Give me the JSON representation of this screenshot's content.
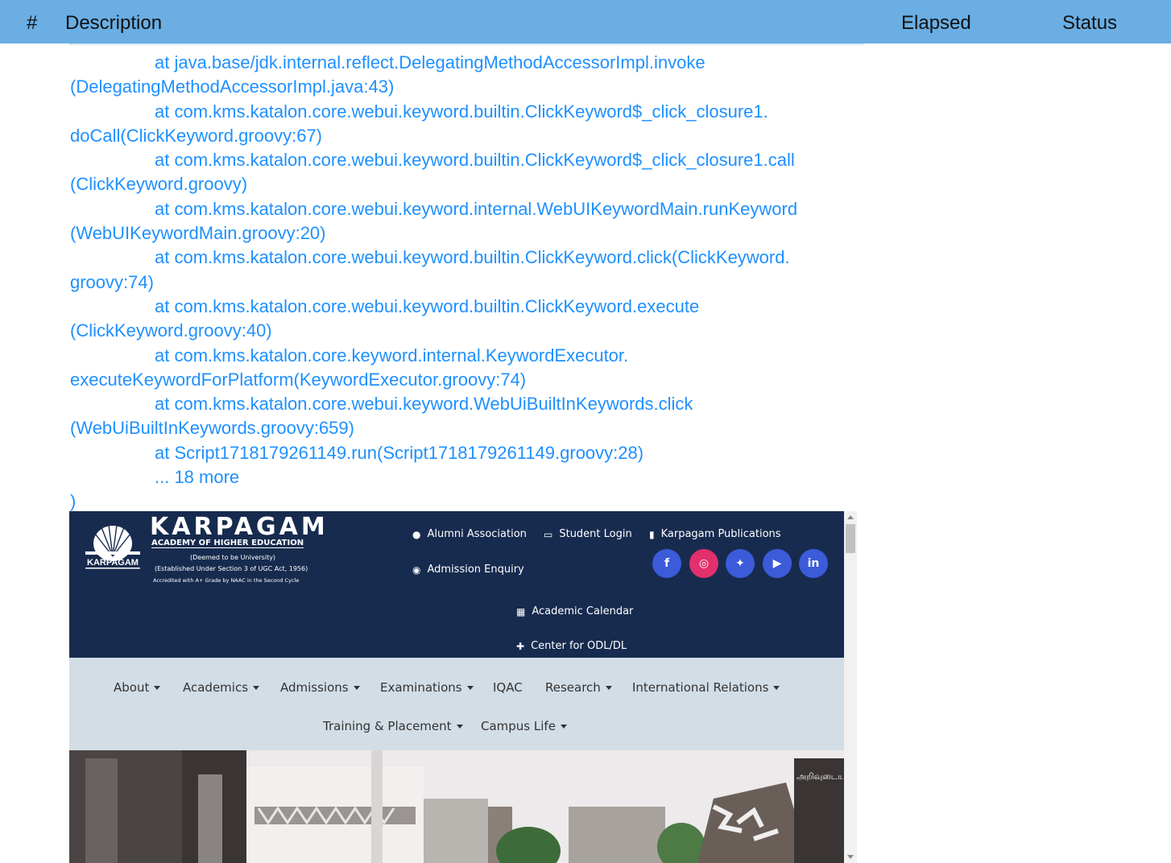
{
  "table_header": {
    "hash": "#",
    "description": "Description",
    "elapsed": "Elapsed",
    "status": "Status"
  },
  "stack_trace": [
    {
      "text": "at java.base/jdk.internal.reflect.DelegatingMethodAccessorImpl.invoke",
      "indent": true
    },
    {
      "text": "(DelegatingMethodAccessorImpl.java:43)",
      "indent": false
    },
    {
      "text": "at com.kms.katalon.core.webui.keyword.builtin.ClickKeyword$_click_closure1.",
      "indent": true
    },
    {
      "text": "doCall(ClickKeyword.groovy:67)",
      "indent": false
    },
    {
      "text": "at com.kms.katalon.core.webui.keyword.builtin.ClickKeyword$_click_closure1.call",
      "indent": true
    },
    {
      "text": "(ClickKeyword.groovy)",
      "indent": false
    },
    {
      "text": "at com.kms.katalon.core.webui.keyword.internal.WebUIKeywordMain.runKeyword",
      "indent": true
    },
    {
      "text": "(WebUIKeywordMain.groovy:20)",
      "indent": false
    },
    {
      "text": "at com.kms.katalon.core.webui.keyword.builtin.ClickKeyword.click(ClickKeyword.",
      "indent": true
    },
    {
      "text": "groovy:74)",
      "indent": false
    },
    {
      "text": "at com.kms.katalon.core.webui.keyword.builtin.ClickKeyword.execute",
      "indent": true
    },
    {
      "text": "(ClickKeyword.groovy:40)",
      "indent": false
    },
    {
      "text": "at com.kms.katalon.core.keyword.internal.KeywordExecutor.",
      "indent": true
    },
    {
      "text": "executeKeywordForPlatform(KeywordExecutor.groovy:74)",
      "indent": false
    },
    {
      "text": "at com.kms.katalon.core.webui.keyword.WebUiBuiltInKeywords.click",
      "indent": true
    },
    {
      "text": "(WebUiBuiltInKeywords.groovy:659)",
      "indent": false
    },
    {
      "text": "at Script1718179261149.run(Script1718179261149.groovy:28)",
      "indent": true
    },
    {
      "text": "... 18 more",
      "indent": true
    },
    {
      "text": ")",
      "indent": false
    }
  ],
  "site": {
    "logo": {
      "name": "KARPAGAM",
      "subtitle": "ACADEMY OF HIGHER EDUCATION",
      "deemed": "(Deemed to be University)",
      "established": "(Established Under Section 3 of UGC Act, 1956)",
      "accredited": "Accredited with A+ Grade by NAAC in the Second Cycle",
      "emblem_text": "KARPAGAM"
    },
    "top_links": {
      "alumni": "Alumni Association",
      "student_login": "Student Login",
      "publications": "Karpagam Publications",
      "admission_enquiry": "Admission Enquiry",
      "academic_calendar": "Academic Calendar",
      "odl": "Center for ODL/DL"
    },
    "social": [
      {
        "name": "facebook-icon",
        "glyph": "f",
        "color": "#3b5bd9"
      },
      {
        "name": "instagram-icon",
        "glyph": "◎",
        "color": "#e1306c"
      },
      {
        "name": "twitter-icon",
        "glyph": "✦",
        "color": "#3b5bd9"
      },
      {
        "name": "youtube-icon",
        "glyph": "▶",
        "color": "#3b5bd9"
      },
      {
        "name": "linkedin-icon",
        "glyph": "in",
        "color": "#3b5bd9"
      }
    ],
    "nav": {
      "about": "About",
      "academics": "Academics",
      "admissions": "Admissions",
      "examinations": "Examinations",
      "iqac": "IQAC",
      "research": "Research",
      "international": "International Relations",
      "training": "Training & Placement",
      "campus": "Campus Life"
    },
    "hero_sign": "அறிவுடைய"
  }
}
